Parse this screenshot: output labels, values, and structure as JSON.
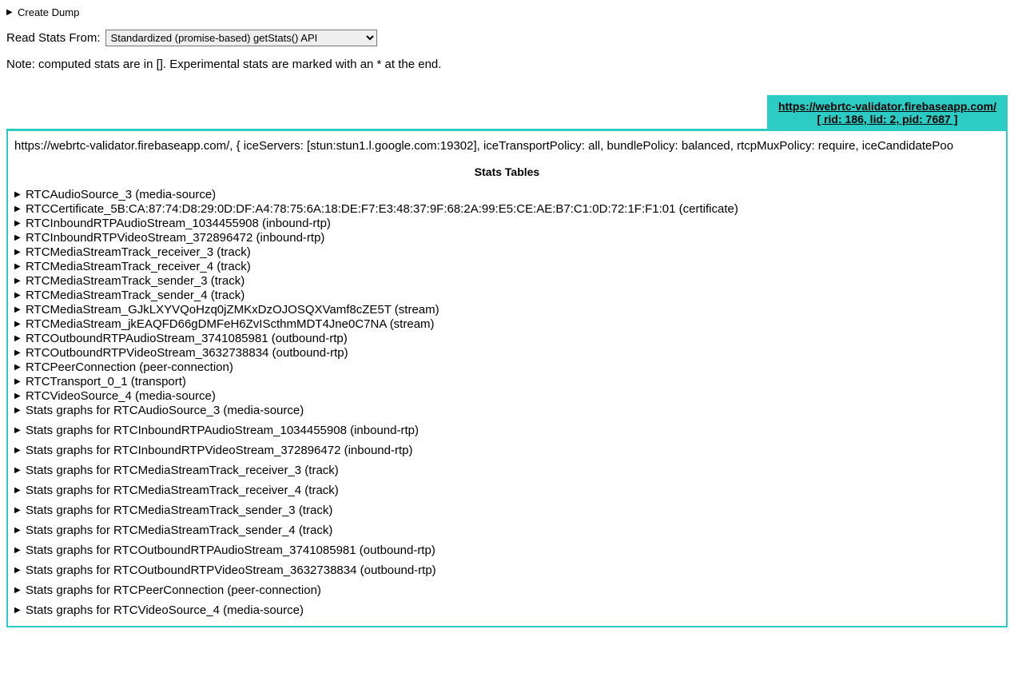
{
  "createDump": "Create Dump",
  "readStatsLabel": "Read Stats From:",
  "selectValue": "Standardized (promise-based) getStats() API",
  "note": "Note: computed stats are in []. Experimental stats are marked with an * at the end.",
  "tab": {
    "url": "https://webrtc-validator.firebaseapp.com/",
    "sub": "[ rid: 186, lid: 2, pid: 7687 ]"
  },
  "connectionInfo": "https://webrtc-validator.firebaseapp.com/, { iceServers: [stun:stun1.l.google.com:19302], iceTransportPolicy: all, bundlePolicy: balanced, rtcpMuxPolicy: require, iceCandidatePoo",
  "statsTablesHeader": "Stats Tables",
  "statsItems": [
    {
      "label": "RTCAudioSource_3 (media-source)",
      "graph": false
    },
    {
      "label": "RTCCertificate_5B:CA:87:74:D8:29:0D:DF:A4:78:75:6A:18:DE:F7:E3:48:37:9F:68:2A:99:E5:CE:AE:B7:C1:0D:72:1F:F1:01 (certificate)",
      "graph": false
    },
    {
      "label": "RTCInboundRTPAudioStream_1034455908 (inbound-rtp)",
      "graph": false
    },
    {
      "label": "RTCInboundRTPVideoStream_372896472 (inbound-rtp)",
      "graph": false
    },
    {
      "label": "RTCMediaStreamTrack_receiver_3 (track)",
      "graph": false
    },
    {
      "label": "RTCMediaStreamTrack_receiver_4 (track)",
      "graph": false
    },
    {
      "label": "RTCMediaStreamTrack_sender_3 (track)",
      "graph": false
    },
    {
      "label": "RTCMediaStreamTrack_sender_4 (track)",
      "graph": false
    },
    {
      "label": "RTCMediaStream_GJkLXYVQoHzq0jZMKxDzOJOSQXVamf8cZE5T (stream)",
      "graph": false
    },
    {
      "label": "RTCMediaStream_jkEAQFD66gDMFeH6ZvIScthmMDT4Jne0C7NA (stream)",
      "graph": false
    },
    {
      "label": "RTCOutboundRTPAudioStream_3741085981 (outbound-rtp)",
      "graph": false
    },
    {
      "label": "RTCOutboundRTPVideoStream_3632738834 (outbound-rtp)",
      "graph": false
    },
    {
      "label": "RTCPeerConnection (peer-connection)",
      "graph": false
    },
    {
      "label": "RTCTransport_0_1 (transport)",
      "graph": false
    },
    {
      "label": "RTCVideoSource_4 (media-source)",
      "graph": false
    },
    {
      "label": "Stats graphs for RTCAudioSource_3 (media-source)",
      "graph": false
    },
    {
      "label": "Stats graphs for RTCInboundRTPAudioStream_1034455908 (inbound-rtp)",
      "graph": true
    },
    {
      "label": "Stats graphs for RTCInboundRTPVideoStream_372896472 (inbound-rtp)",
      "graph": true
    },
    {
      "label": "Stats graphs for RTCMediaStreamTrack_receiver_3 (track)",
      "graph": true
    },
    {
      "label": "Stats graphs for RTCMediaStreamTrack_receiver_4 (track)",
      "graph": true
    },
    {
      "label": "Stats graphs for RTCMediaStreamTrack_sender_3 (track)",
      "graph": true
    },
    {
      "label": "Stats graphs for RTCMediaStreamTrack_sender_4 (track)",
      "graph": true
    },
    {
      "label": "Stats graphs for RTCOutboundRTPAudioStream_3741085981 (outbound-rtp)",
      "graph": true
    },
    {
      "label": "Stats graphs for RTCOutboundRTPVideoStream_3632738834 (outbound-rtp)",
      "graph": true
    },
    {
      "label": "Stats graphs for RTCPeerConnection (peer-connection)",
      "graph": true
    },
    {
      "label": "Stats graphs for RTCVideoSource_4 (media-source)",
      "graph": true
    }
  ]
}
